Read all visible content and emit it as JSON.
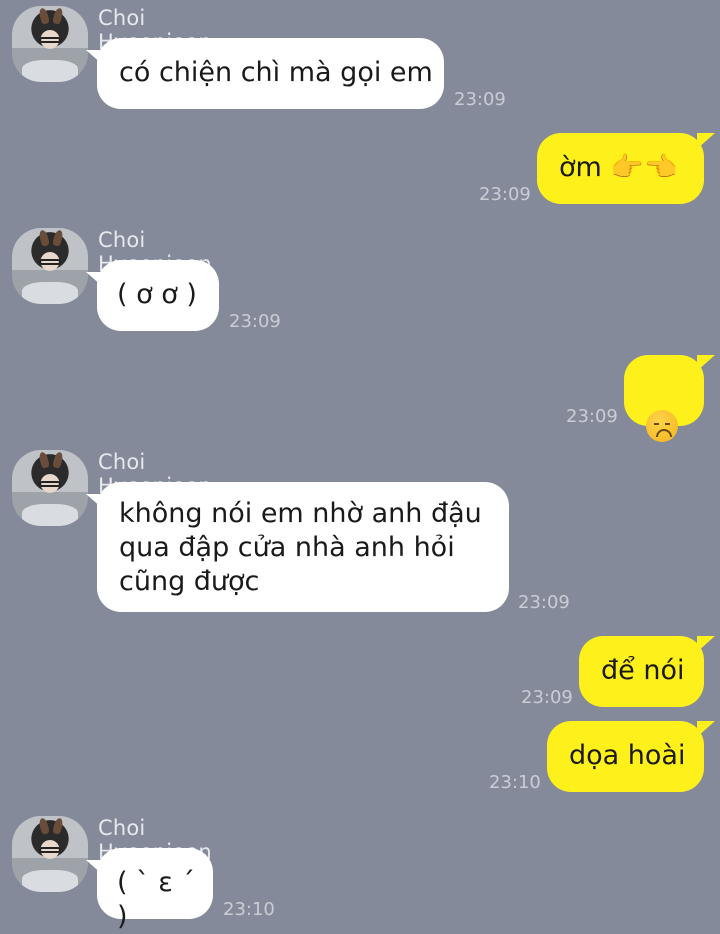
{
  "sender_name": "Choi Hyeonjoon",
  "messages": [
    {
      "dir": "in",
      "text": "có chiện chì mà gọi em",
      "time": "23:09"
    },
    {
      "dir": "out",
      "text": "ờm 👉👈",
      "time": "23:09"
    },
    {
      "dir": "in",
      "text": "( ơ ơ )",
      "time": "23:09"
    },
    {
      "dir": "out",
      "text": "",
      "icon": "disappointed-face-emoji",
      "time": "23:09"
    },
    {
      "dir": "in",
      "text": "không nói em nhờ anh đậu\nqua đập cửa nhà anh hỏi\ncũng được",
      "time": "23:09"
    },
    {
      "dir": "out",
      "text": "để nói",
      "time": "23:09"
    },
    {
      "dir": "out",
      "text": "dọa hoài",
      "time": "23:10"
    },
    {
      "dir": "in",
      "text": "( ˋ ε ˊ )",
      "time": "23:10"
    }
  ],
  "colors": {
    "background": "#848a9a",
    "incoming_bubble": "#ffffff",
    "outgoing_bubble": "#fef01b",
    "timestamp": "#c9cdd5",
    "sender_name": "#e6e8ec"
  }
}
